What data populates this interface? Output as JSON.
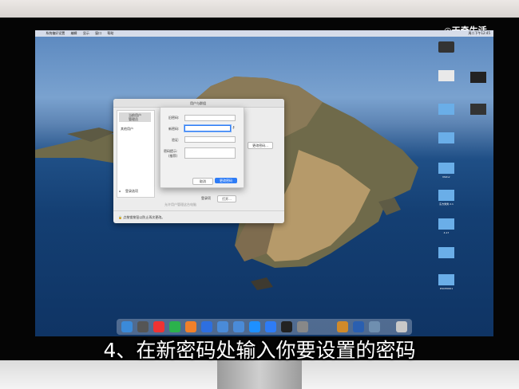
{
  "menubar": {
    "items": [
      "系统偏好设置",
      "编辑",
      "显示",
      "窗口",
      "帮助"
    ],
    "clock": "周二下午12:45"
  },
  "window": {
    "title": "用户与群组",
    "sidebar_user_name": "当前用户",
    "sidebar_user_role": "管理员",
    "sidebar_other": "其他用户",
    "login_options": "登录选项",
    "change_password_button": "更改密码...",
    "login_items_label": "登录项",
    "open_button": "打开...",
    "allow_admin_label": "允许用户管理这台电脑",
    "lock_text": "点按锁按钮以防止再次更改。"
  },
  "sheet": {
    "old_password_label": "旧密码:",
    "new_password_label": "新密码:",
    "verify_label": "验证:",
    "hint_label": "密码提示:",
    "hint_sub": "(推荐)",
    "cancel_button": "取消",
    "confirm_button": "更改密码"
  },
  "desktop_icons": [
    "",
    "",
    "",
    "",
    "Mixtur",
    "",
    "东方秀秀 2.1",
    "4.17",
    "",
    "DSCPO001"
  ],
  "subtitle": "4、在新密码处输入你要设置的密码",
  "watermark": {
    "brand": "天奇生活",
    "corner": "天奇"
  },
  "colors": {
    "accent": "#2e7cf6",
    "subtitle": "#ffffff"
  }
}
